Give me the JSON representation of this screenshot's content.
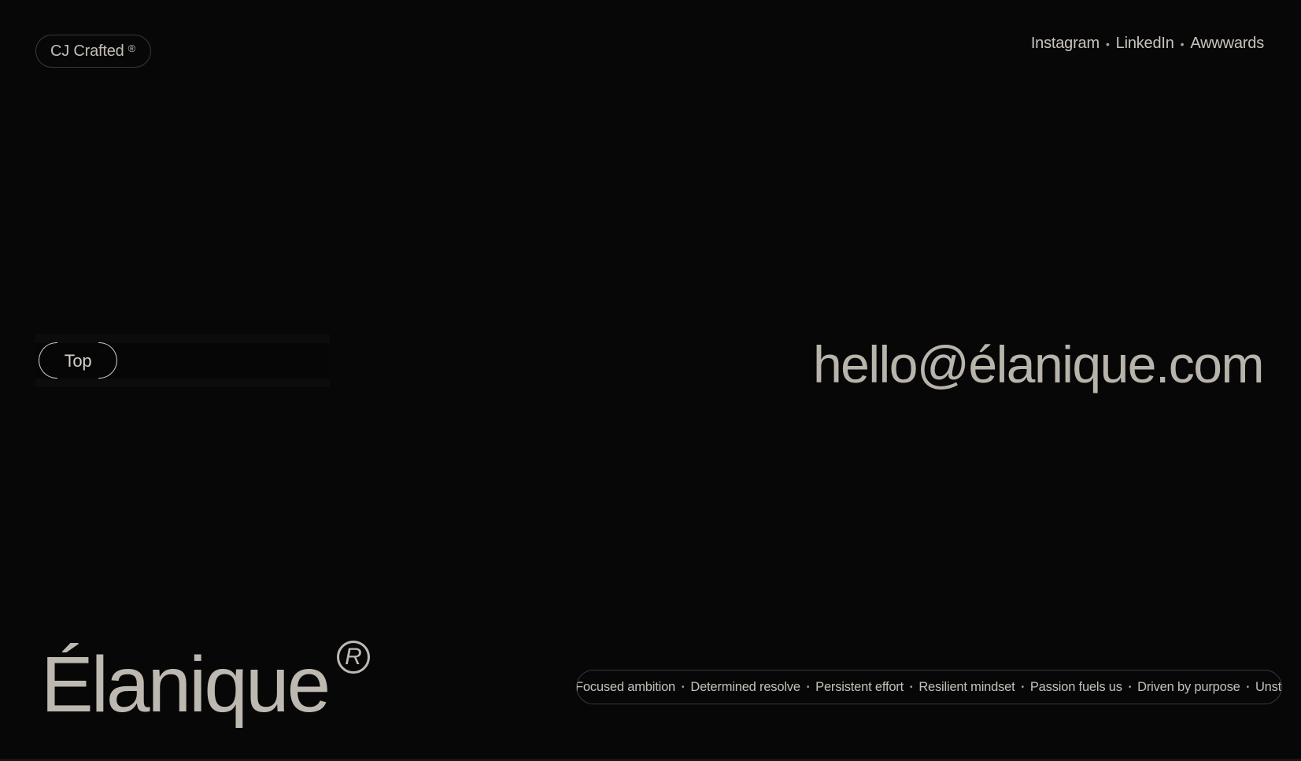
{
  "header": {
    "badge_label": "CJ Crafted",
    "badge_mark": "®",
    "social_links": [
      "Instagram",
      "LinkedIn",
      "Awwwards"
    ],
    "separator": "•"
  },
  "main": {
    "top_button_label": "Top",
    "email": "hello@élanique.com"
  },
  "footer": {
    "brand_name": "Élanique",
    "brand_mark": "R",
    "marquee_items": [
      "Focused ambition",
      "Determined resolve",
      "Persistent effort",
      "Resilient mindset",
      "Passion fuels us",
      "Driven by purpose",
      "Unst"
    ]
  },
  "colors": {
    "background": "#070707",
    "text": "#c8c4bc",
    "border": "#3a3a3a"
  }
}
